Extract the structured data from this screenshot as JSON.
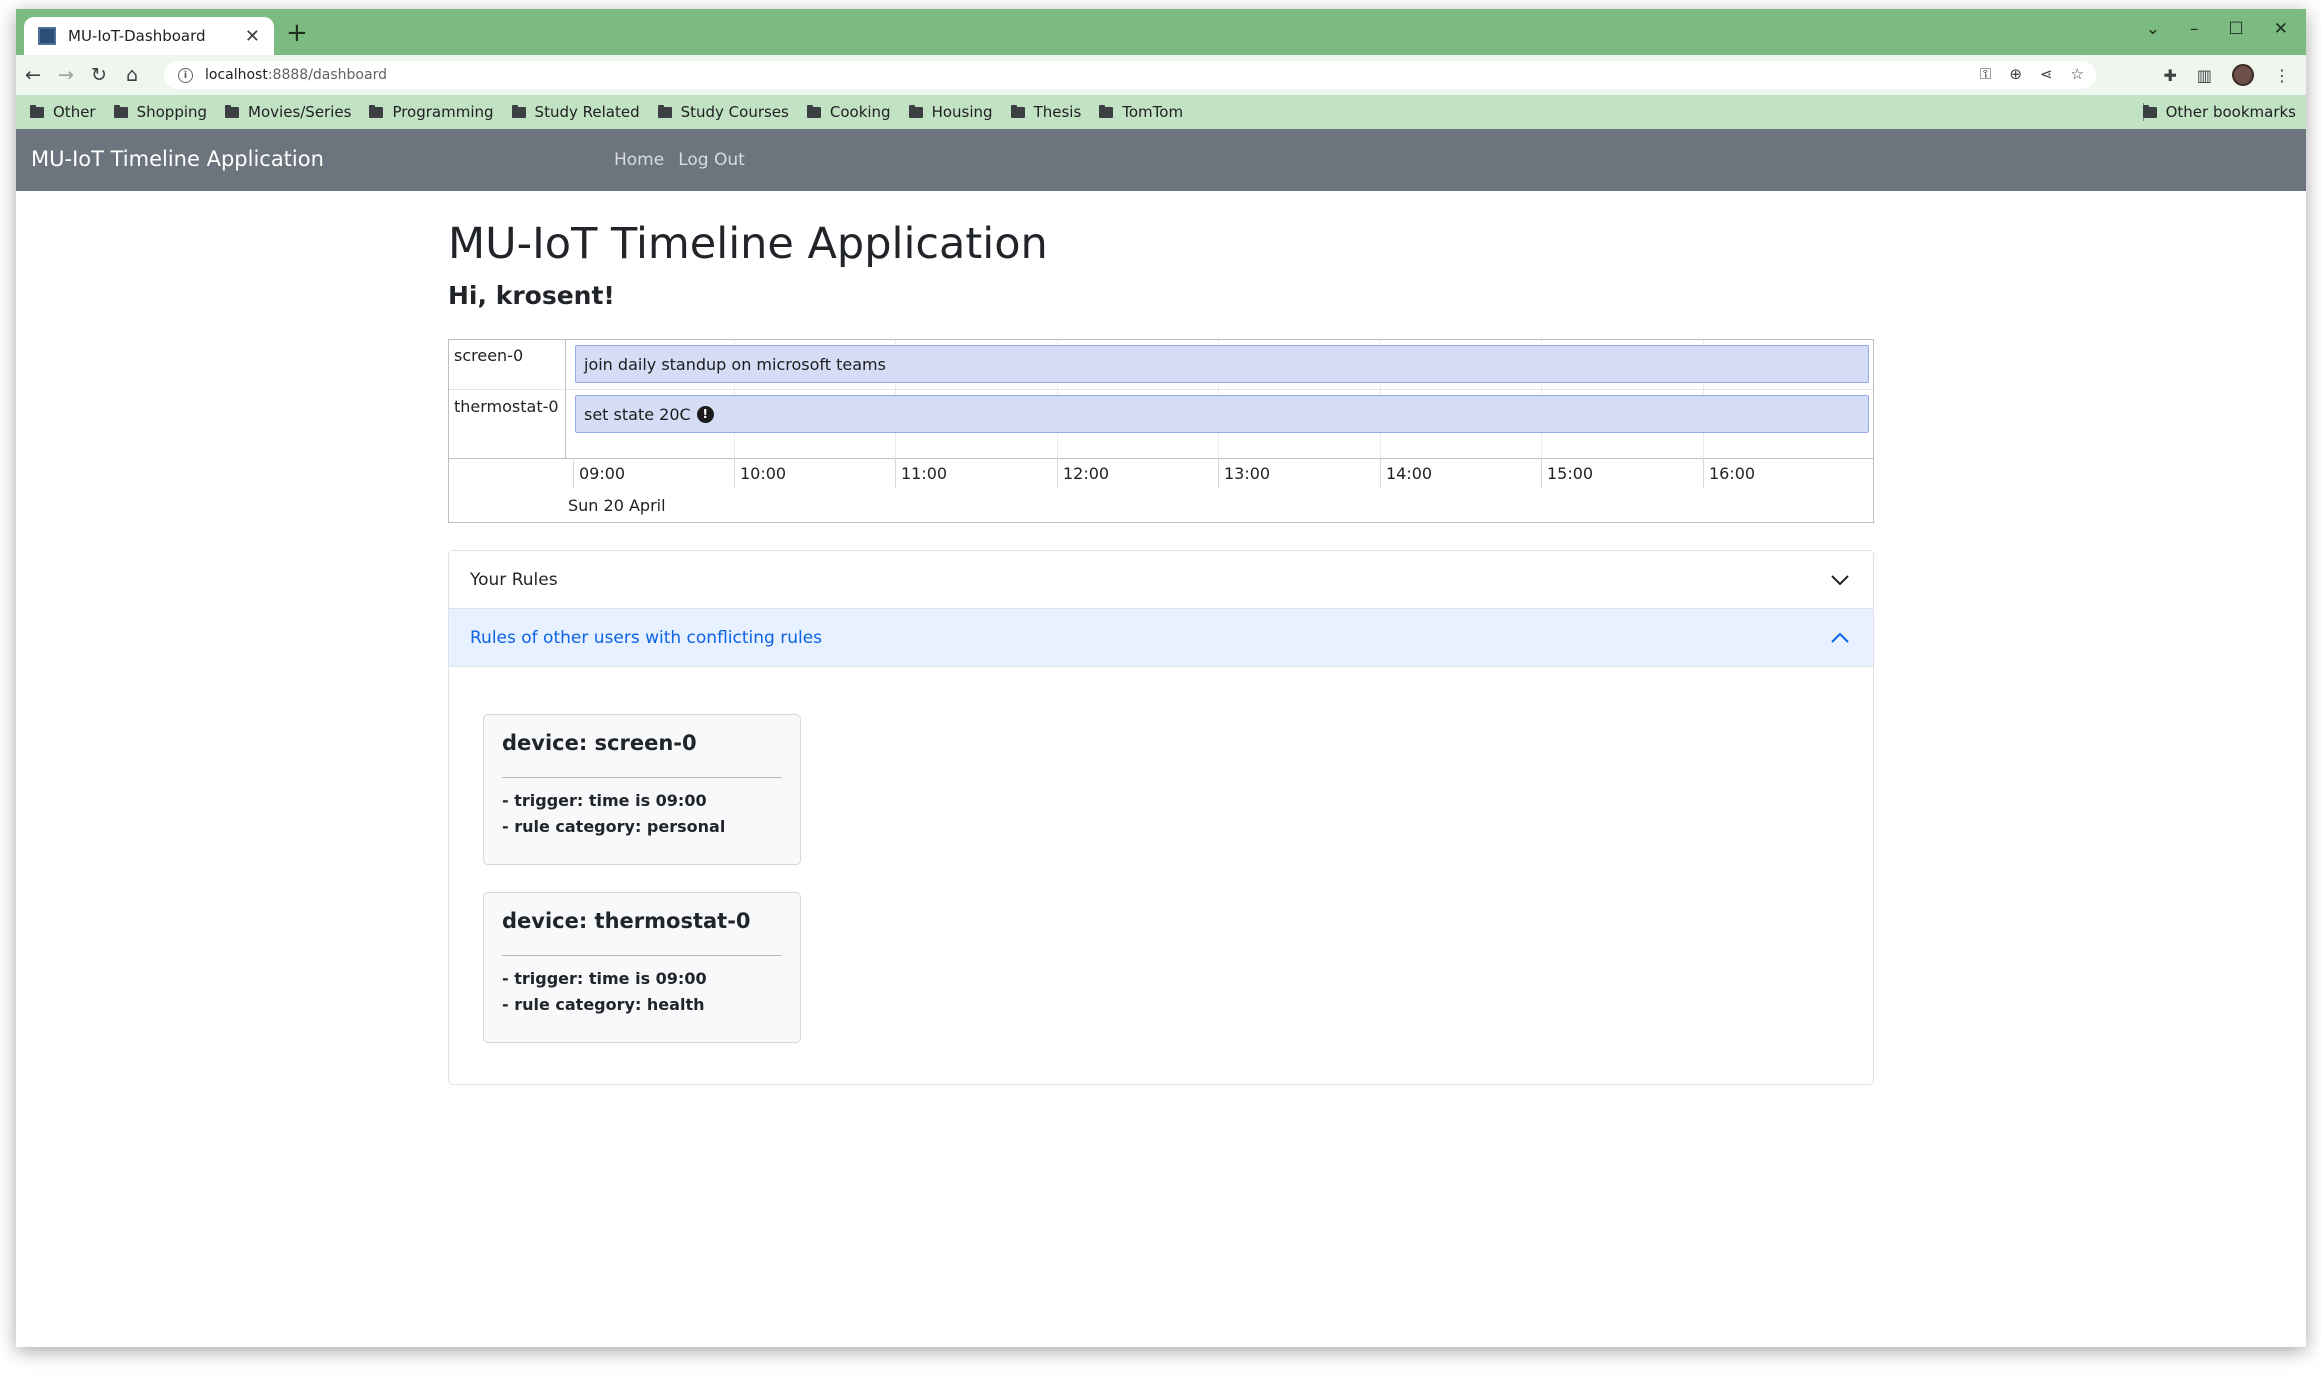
{
  "browser": {
    "tab_title": "MU-IoT-Dashboard",
    "url_host": "localhost",
    "url_rest": ":8888/dashboard",
    "bookmarks": [
      "Other",
      "Shopping",
      "Movies/Series",
      "Programming",
      "Study Related",
      "Study Courses",
      "Cooking",
      "Housing",
      "Thesis",
      "TomTom"
    ],
    "other_bookmarks": "Other bookmarks"
  },
  "navbar": {
    "brand": "MU-IoT Timeline Application",
    "links": [
      "Home",
      "Log Out"
    ]
  },
  "page": {
    "title": "MU-IoT Timeline Application",
    "greeting": "Hi, krosent!"
  },
  "timeline": {
    "rows": [
      {
        "device": "screen-0",
        "item": "join daily standup on microsoft teams",
        "warning": false
      },
      {
        "device": "thermostat-0",
        "item": "set state 20C",
        "warning": true
      }
    ],
    "ticks": [
      "09:00",
      "10:00",
      "11:00",
      "12:00",
      "13:00",
      "14:00",
      "15:00",
      "16:00"
    ],
    "date": "Sun 20 April",
    "item_color": "#d5ddf6"
  },
  "accordion": {
    "section1": {
      "label": "Your Rules",
      "expanded": false
    },
    "section2": {
      "label": "Rules of other users with conflicting rules",
      "expanded": true
    },
    "cards": [
      {
        "title": "device: screen-0",
        "trigger": "- trigger: time is 09:00",
        "category": "- rule category: personal"
      },
      {
        "title": "device: thermostat-0",
        "trigger": "- trigger: time is 09:00",
        "category": "- rule category: health"
      }
    ]
  },
  "colors": {
    "tabstrip": "#7bbb82",
    "bookmarks_bar": "#c2e2c4",
    "navbar": "#6c757d",
    "accent": "#0c63e4"
  }
}
